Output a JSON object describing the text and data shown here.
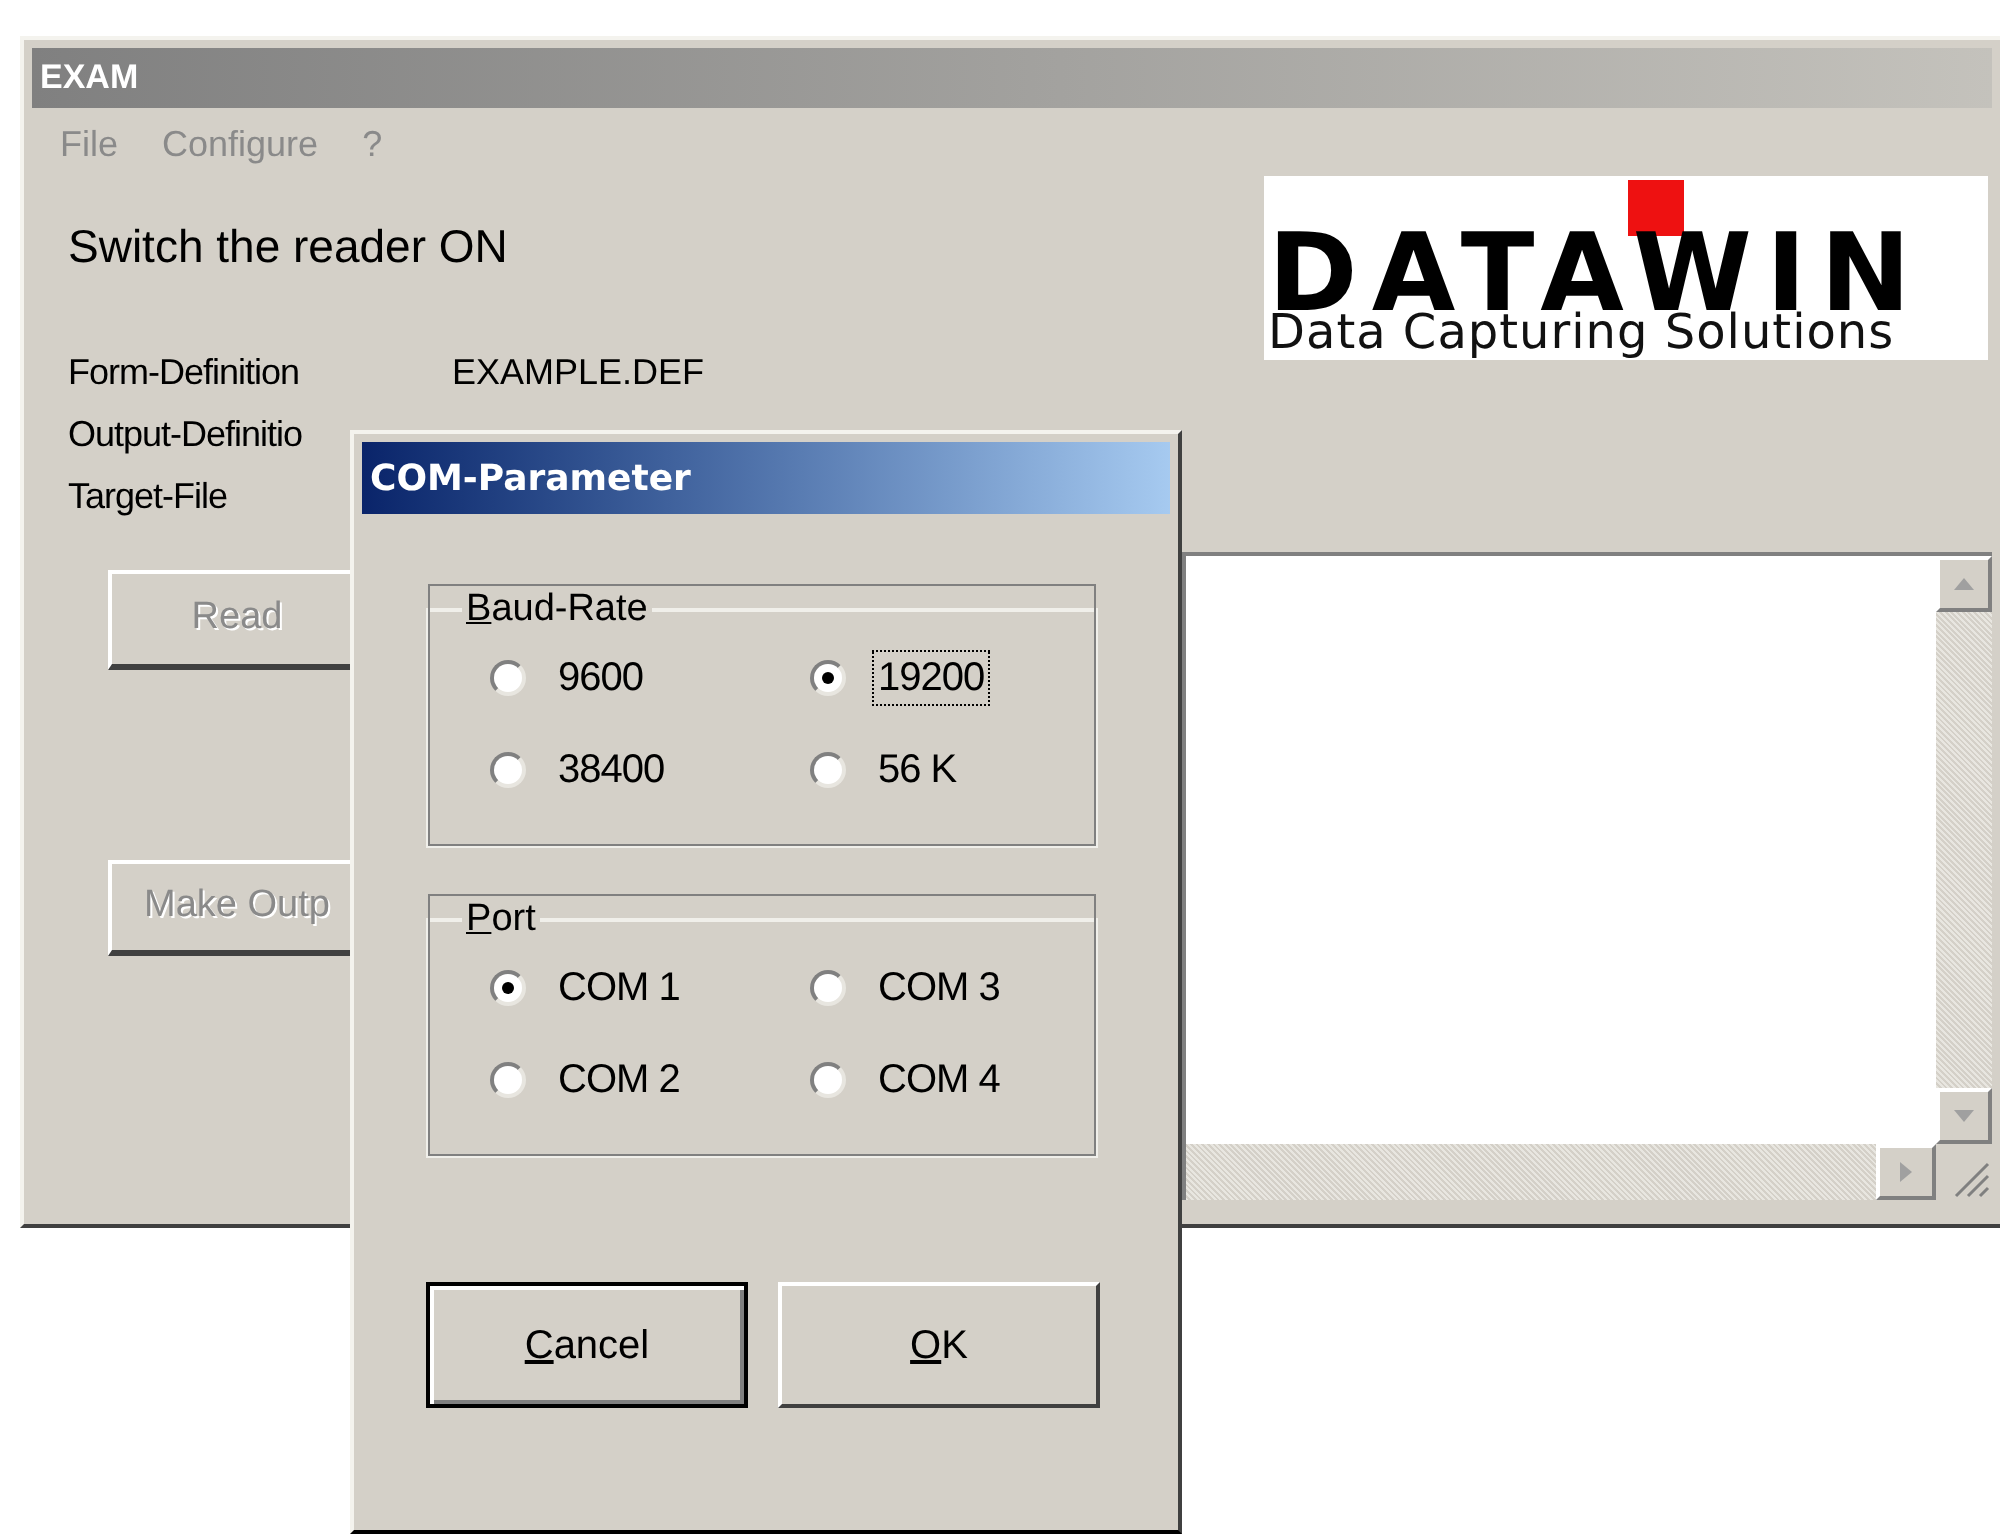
{
  "main_window": {
    "title": "EXAM",
    "menu": [
      {
        "label": "File",
        "disabled": true
      },
      {
        "label": "Configure",
        "disabled": true
      },
      {
        "label": "?",
        "disabled": true
      }
    ],
    "status_message": "Switch the reader ON",
    "fields": [
      {
        "label": "Form-Definition",
        "value": "EXAMPLE.DEF"
      },
      {
        "label": "Output-Definitio"
      },
      {
        "label": "Target-File"
      }
    ],
    "buttons": [
      {
        "label": "Read",
        "disabled": true
      },
      {
        "label": "Make Outp",
        "disabled": true
      }
    ],
    "logo": {
      "name": "DATAWIN",
      "tagline": "Data Capturing Solutions"
    }
  },
  "dialog": {
    "title": "COM-Parameter",
    "groups": [
      {
        "label": "Baud-Rate",
        "options": [
          {
            "label": "9600",
            "selected": false,
            "focused": false
          },
          {
            "label": "19200",
            "selected": true,
            "focused": true
          },
          {
            "label": "38400",
            "selected": false,
            "focused": false
          },
          {
            "label": "56 K",
            "selected": false,
            "focused": false
          }
        ]
      },
      {
        "label": "Port",
        "options": [
          {
            "label": "COM 1",
            "selected": true,
            "focused": false
          },
          {
            "label": "COM 3",
            "selected": false,
            "focused": false
          },
          {
            "label": "COM 2",
            "selected": false,
            "focused": false
          },
          {
            "label": "COM 4",
            "selected": false,
            "focused": false
          }
        ]
      }
    ],
    "buttons": [
      {
        "label": "Cancel",
        "default": true
      },
      {
        "label": "OK",
        "default": false
      }
    ]
  }
}
